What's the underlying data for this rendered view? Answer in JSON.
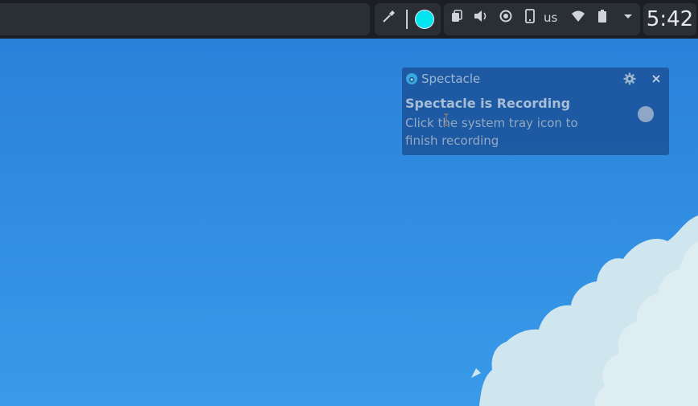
{
  "panel": {
    "color_picker_icon": "eyedropper-icon",
    "picked_color": "#00e5f0",
    "tray_icons": [
      "clipboard-icon",
      "volume-icon",
      "brightness-icon",
      "device-icon",
      "wifi-icon",
      "battery-icon",
      "chevron-down-icon"
    ],
    "keyboard_layout": "us",
    "clock": "5:42"
  },
  "notification": {
    "app_icon": "spectacle-icon",
    "app_name": "Spectacle",
    "settings_icon": "gear-icon",
    "close_icon": "close-icon",
    "title": "Spectacle is Recording",
    "body": "Click the system tray icon to finish recording"
  },
  "colors": {
    "panel_bg": "#1b1f24",
    "panel_segment": "#2a2f36",
    "desktop_top": "#2a7fd7",
    "desktop_bottom": "#3a9ae9"
  }
}
